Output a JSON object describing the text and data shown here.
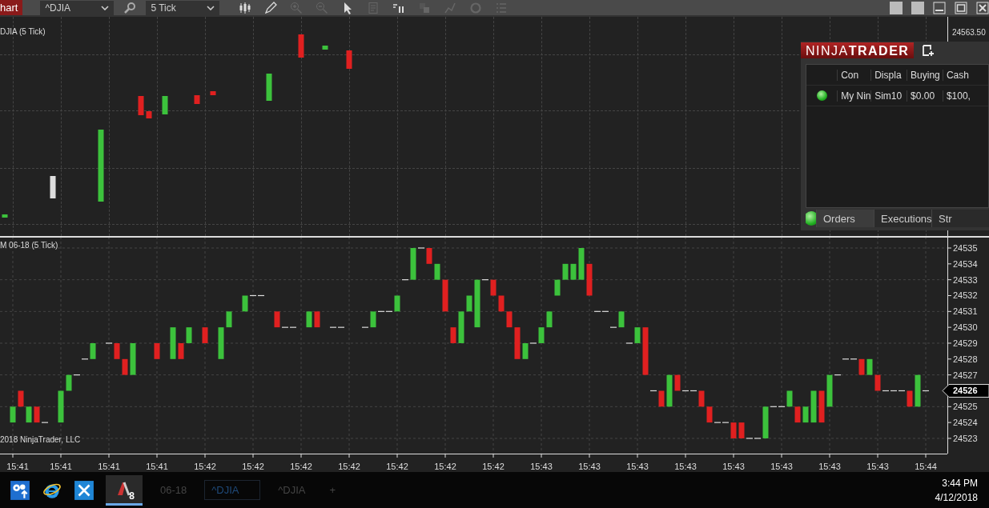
{
  "toolbar": {
    "chart_button": "hart",
    "instrument": "^DJIA",
    "interval": "5 Tick"
  },
  "top_panel": {
    "label": "DJIA (5 Tick)",
    "price_label": "24563.50"
  },
  "bottom_panel": {
    "label": "M 06-18 (5 Tick)",
    "copyright": "2018 NinjaTrader, LLC",
    "y_axis_labels": [
      {
        "label": "24535",
        "current": false
      },
      {
        "label": "24534",
        "current": false
      },
      {
        "label": "24533",
        "current": false
      },
      {
        "label": "24532",
        "current": false
      },
      {
        "label": "24531",
        "current": false
      },
      {
        "label": "24530",
        "current": false
      },
      {
        "label": "24529",
        "current": false
      },
      {
        "label": "24528",
        "current": false
      },
      {
        "label": "24527",
        "current": false
      },
      {
        "label": "24526",
        "current": true
      },
      {
        "label": "24525",
        "current": false
      },
      {
        "label": "24524",
        "current": false
      },
      {
        "label": "24523",
        "current": false
      }
    ],
    "x_axis_labels": [
      "15:41",
      "15:41",
      "15:41",
      "15:41",
      "15:42",
      "15:42",
      "15:42",
      "15:42",
      "15:42",
      "15:42",
      "15:42",
      "15:43",
      "15:43",
      "15:43",
      "15:43",
      "15:43",
      "15:43",
      "15:43",
      "15:43",
      "15:44"
    ]
  },
  "account_panel": {
    "logo": "NINJA**TRADER**",
    "columns": [
      "Con",
      "Displa",
      "Buying",
      "Cash"
    ],
    "rows": [
      {
        "connected": true,
        "cells": [
          "My Nin",
          "Sim10",
          "$0.00",
          "$100,"
        ]
      }
    ],
    "status_connected": true,
    "tabs": [
      {
        "label": "Orders",
        "selected": true
      },
      {
        "label": "Executions",
        "selected": false
      },
      {
        "label": "Str",
        "selected": false
      }
    ]
  },
  "taskbar": {
    "app_badge": "8",
    "tabs": [
      {
        "label": "06-18",
        "selected": false
      },
      {
        "label": "^DJIA",
        "selected": true
      },
      {
        "label": "^DJIA",
        "selected": false
      },
      {
        "label": "+",
        "selected": false
      }
    ],
    "time": "3:44 PM",
    "date": "4/12/2018"
  }
}
